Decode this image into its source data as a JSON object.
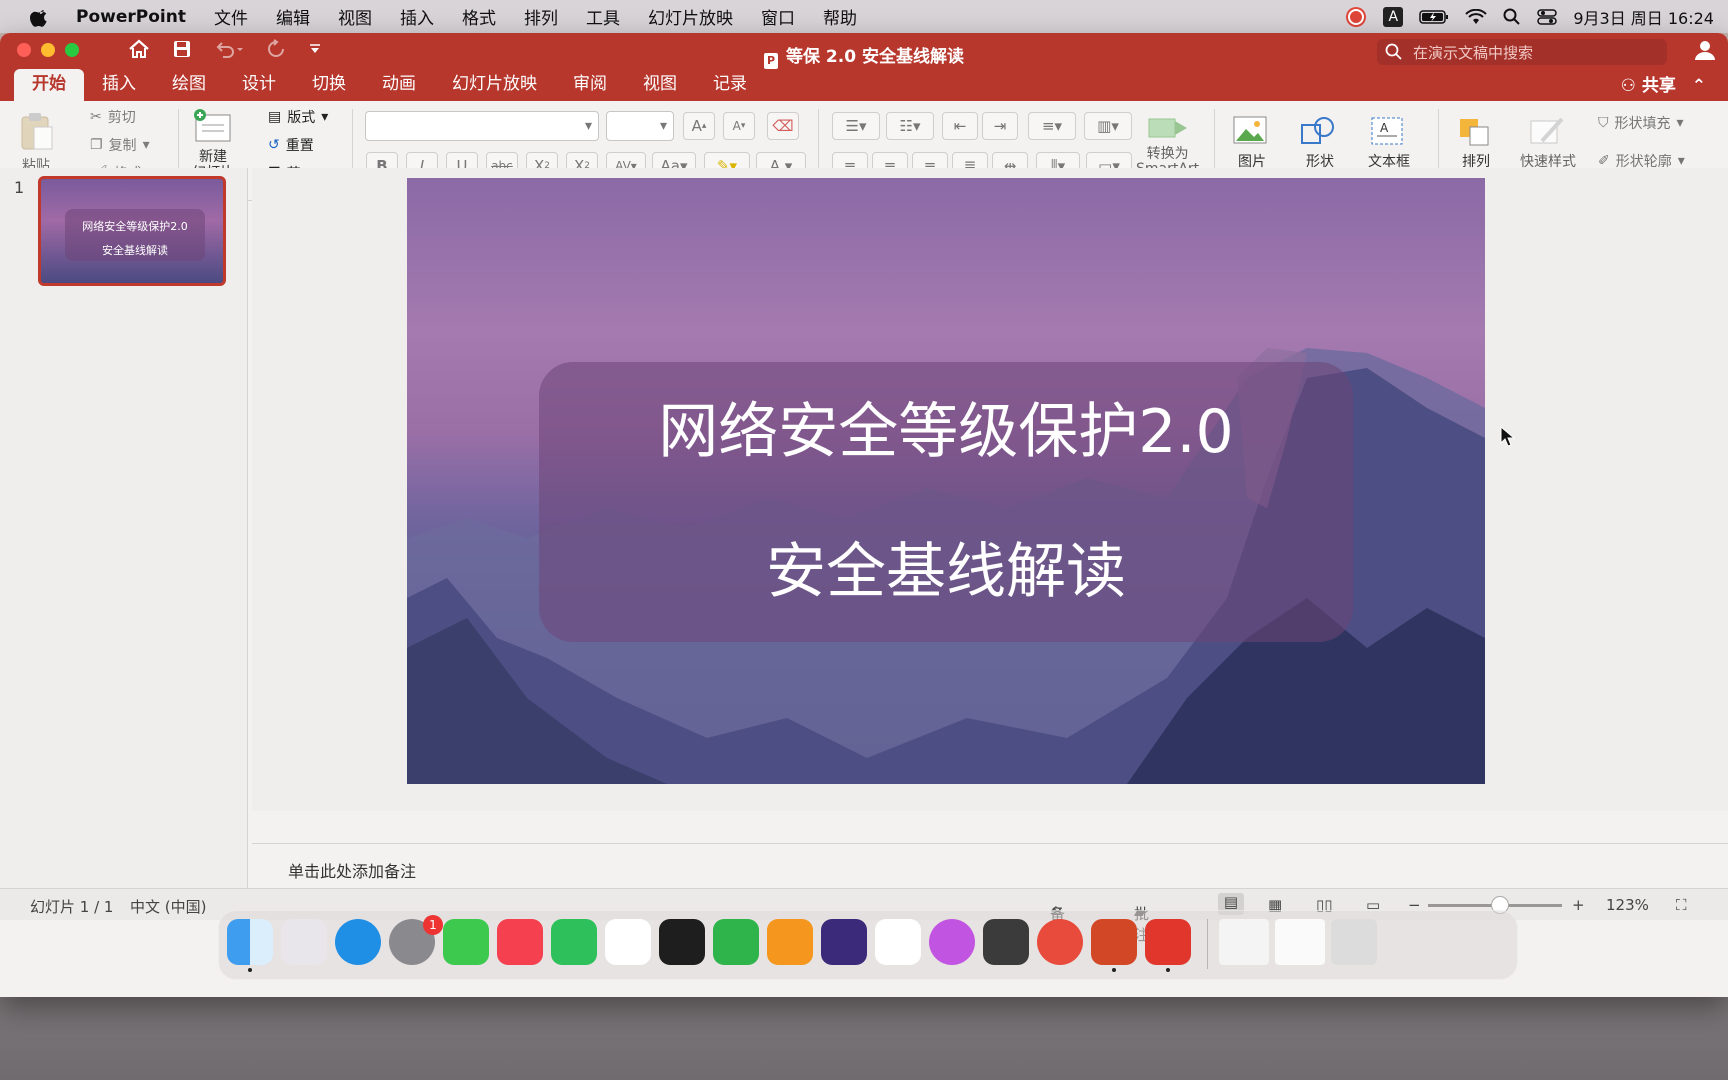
{
  "menubar": {
    "app_name": "PowerPoint",
    "items": [
      "文件",
      "编辑",
      "视图",
      "插入",
      "格式",
      "排列",
      "工具",
      "幻灯片放映",
      "窗口",
      "帮助"
    ],
    "datetime": "9月3日 周日 16:24",
    "input_method": "A"
  },
  "window": {
    "doc_title": "等保 2.0 安全基线解读",
    "search_placeholder": "在演示文稿中搜索",
    "share_label": "共享",
    "tabs": [
      "开始",
      "插入",
      "绘图",
      "设计",
      "切换",
      "动画",
      "幻灯片放映",
      "审阅",
      "视图",
      "记录"
    ],
    "active_tab": "开始"
  },
  "ribbon": {
    "paste": "粘贴",
    "cut": "剪切",
    "copy": "复制",
    "format_painter": "格式",
    "new_slide": "新建\n幻灯片",
    "layout": "版式",
    "reset": "重置",
    "section": "节",
    "convert_smartart_line1": "转换为",
    "convert_smartart_line2": "SmartArt",
    "picture": "图片",
    "shape": "形状",
    "textbox": "文本框",
    "arrange": "排列",
    "quick_styles": "快速样式",
    "shape_fill": "形状填充",
    "shape_outline": "形状轮廓"
  },
  "thumbnails": [
    {
      "number": "1",
      "line1": "网络安全等级保护2.0",
      "line2": "安全基线解读"
    }
  ],
  "slide": {
    "title_line1": "网络安全等级保护2.0",
    "title_line2": "安全基线解读"
  },
  "notes_placeholder": "单击此处添加备注",
  "statusbar": {
    "slide_counter": "幻灯片 1 / 1",
    "language": "中文 (中国)",
    "notes_label": "备注",
    "comments_label": "批注",
    "zoom": "123%"
  },
  "dock": {
    "system_prefs_badge": "1"
  },
  "colors": {
    "accent": "#b7372d",
    "slide_overlay": "#6e4678"
  }
}
